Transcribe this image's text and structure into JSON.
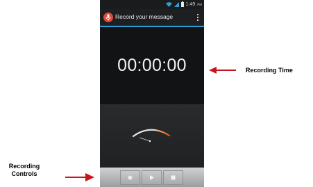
{
  "status_bar": {
    "time": "1:49",
    "ampm": "PM"
  },
  "action_bar": {
    "title": "Record your message",
    "icon": "microphone-icon"
  },
  "recorder": {
    "elapsed": "00:00:00"
  },
  "controls": [
    {
      "name": "record-button",
      "icon": "record-icon"
    },
    {
      "name": "play-button",
      "icon": "play-icon"
    },
    {
      "name": "stop-button",
      "icon": "stop-icon"
    }
  ],
  "annotations": {
    "recording_time": "Recording Time",
    "recording_controls_line1": "Recording",
    "recording_controls_line2": "Controls"
  },
  "colors": {
    "accent": "#2c9fd8",
    "arrow": "#c8141c",
    "mic_badge": "#e04a35"
  }
}
